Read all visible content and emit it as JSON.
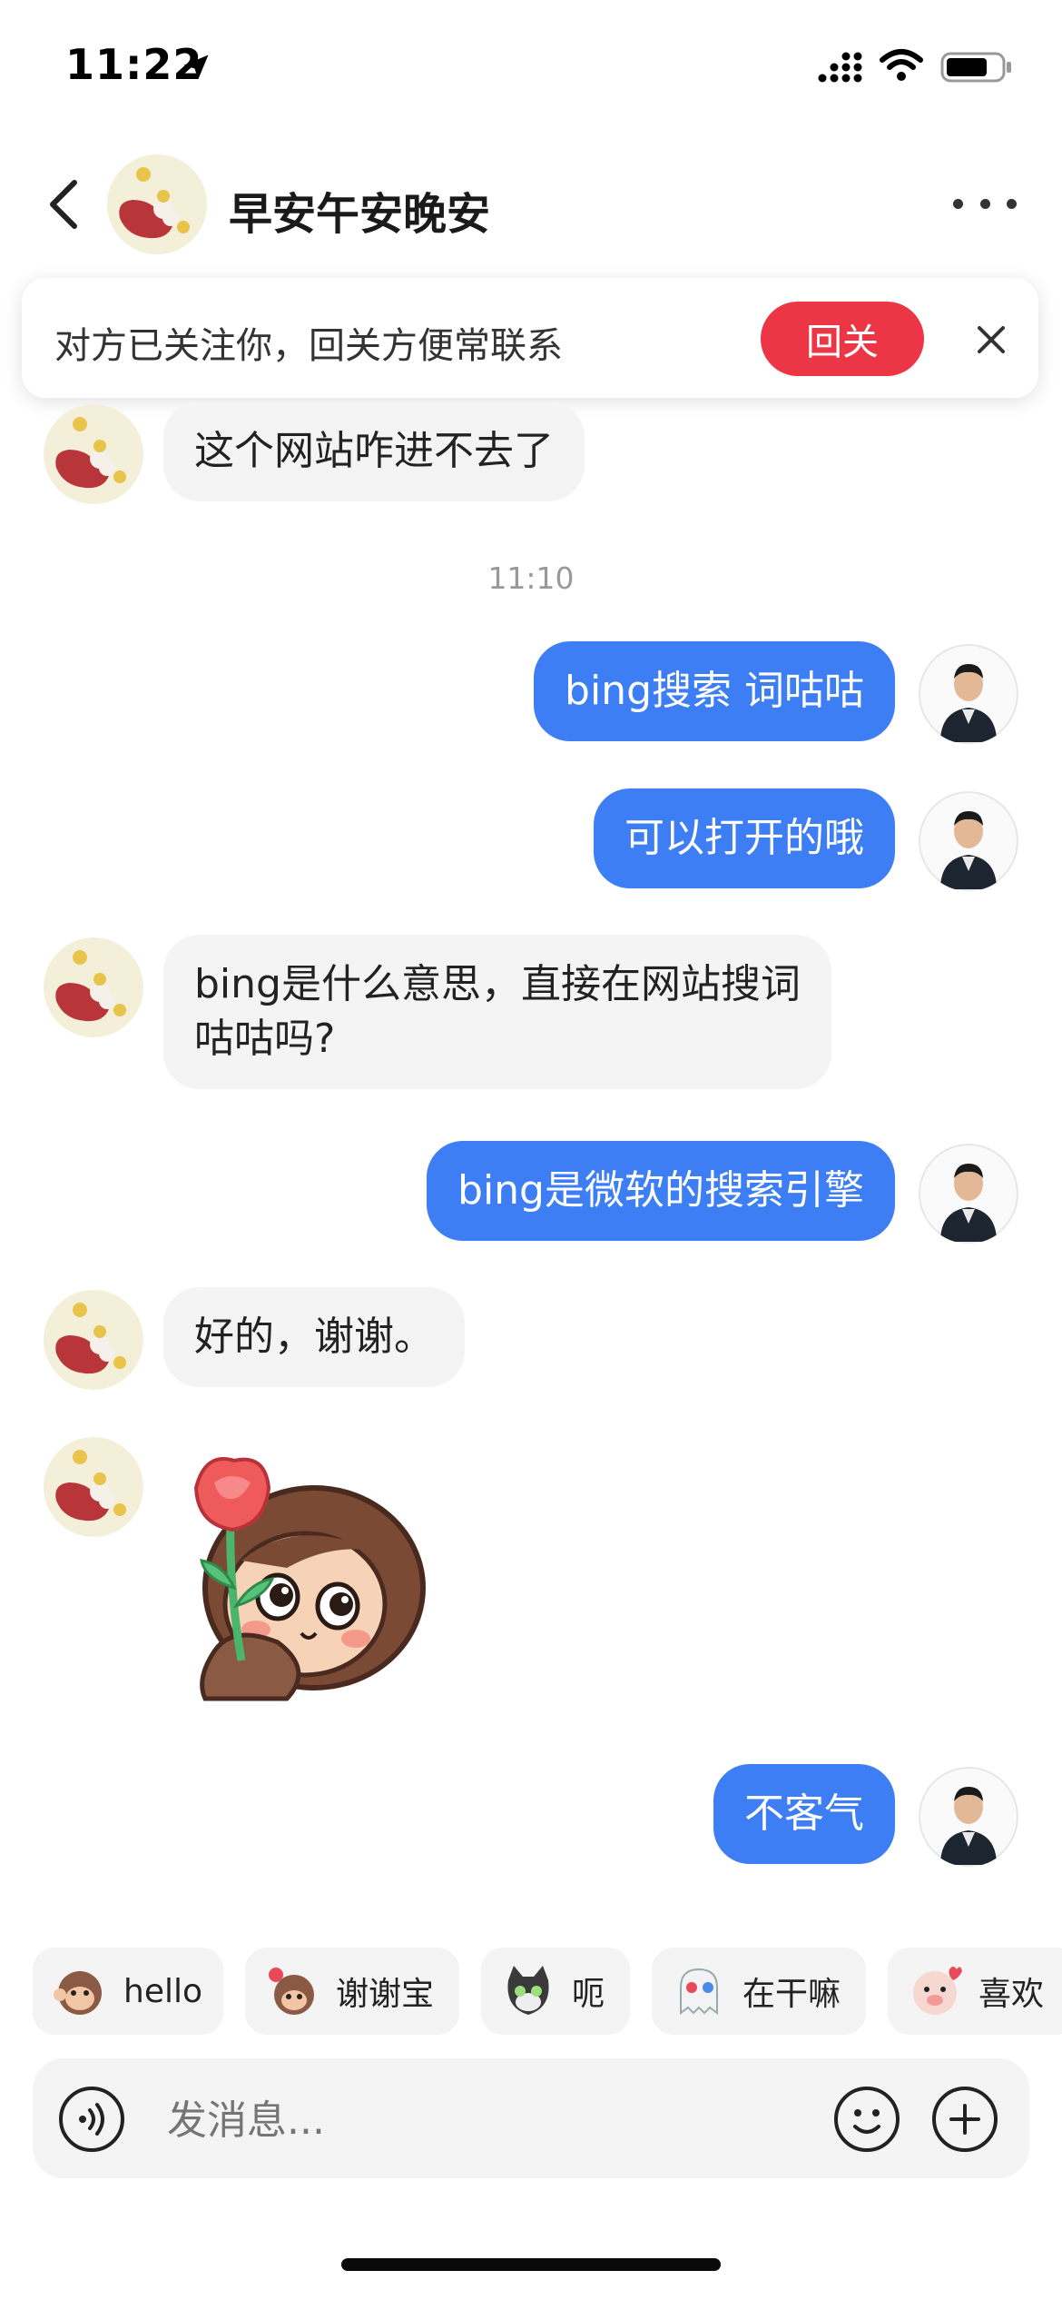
{
  "status_bar": {
    "time": "11:22"
  },
  "header": {
    "title": "早安午安晚安"
  },
  "follow_banner": {
    "text": "对方已关注你，回关方便常联系",
    "button_label": "回关"
  },
  "messages": [
    {
      "side": "in",
      "text": "这个网站咋进不去了"
    },
    {
      "type": "time",
      "text": "11:10"
    },
    {
      "side": "out",
      "text": "bing搜索 词咕咕"
    },
    {
      "side": "out",
      "text": "可以打开的哦"
    },
    {
      "side": "in",
      "text": "bing是什么意思，直接在网站搜词\n咕咕吗?"
    },
    {
      "side": "out",
      "text": "bing是微软的搜索引擎"
    },
    {
      "side": "in",
      "text": "好的，谢谢。"
    },
    {
      "side": "in",
      "type": "sticker",
      "sticker": "girl-holding-rose-sticker"
    },
    {
      "side": "out",
      "text": "不客气"
    }
  ],
  "quick_replies": [
    {
      "label": "hello",
      "icon": "monkey-hello-icon"
    },
    {
      "label": "谢谢宝",
      "icon": "monkey-flower-icon"
    },
    {
      "label": "呃",
      "icon": "cat-icon"
    },
    {
      "label": "在干嘛",
      "icon": "ghost-icon"
    },
    {
      "label": "喜欢",
      "icon": "pig-heart-icon"
    }
  ],
  "input": {
    "placeholder": "发消息..."
  },
  "colors": {
    "accent_blue": "#3d7ef5",
    "follow_red": "#ec3545",
    "bubble_gray": "#f4f4f5"
  }
}
